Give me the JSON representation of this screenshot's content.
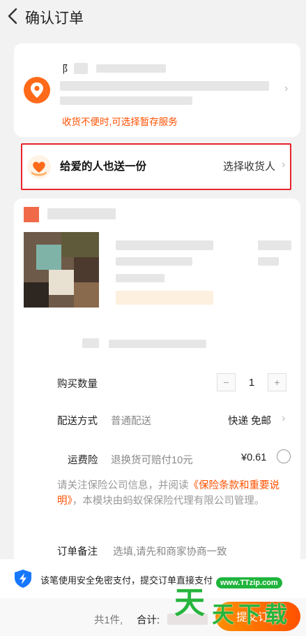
{
  "header": {
    "title": "确认订单"
  },
  "address": {
    "name_initial": "阝",
    "hint": "收货不便时,可选择暂存服务"
  },
  "gift": {
    "title": "给爱的人也送一份",
    "pick_label": "选择收货人"
  },
  "options": {
    "quantity_label": "购买数量",
    "quantity_minus": "−",
    "quantity_value": "1",
    "quantity_plus": "+",
    "delivery_label": "配送方式",
    "delivery_sub": "普通配送",
    "delivery_value": "快递 免邮",
    "insurance_label": "运费险",
    "insurance_sub": "退换货可赔付10元",
    "insurance_price": "¥0.61",
    "notice_before": "请关注保险公司信息，并阅读",
    "notice_link": "《保险条款和重要说明》",
    "notice_after": "，本模块由蚂蚁保保险代理有限公司管理。",
    "remark_label": "订单备注",
    "remark_placeholder": "选填,请先和商家协商一致"
  },
  "pay_tip": {
    "text": "该笔使用安全免密支付，提交订单直接支付"
  },
  "footer": {
    "count": "共1件,",
    "total_label": "合计:",
    "submit_label": "提交订单"
  },
  "watermark": {
    "domain": "www.TTzip.com",
    "chars": [
      "天",
      "天",
      "下",
      "载"
    ]
  },
  "colors": {
    "accent": "#ff5000",
    "gift_border": "#e8242b",
    "shield": "#1677ff",
    "watermark": "#27b53d"
  }
}
